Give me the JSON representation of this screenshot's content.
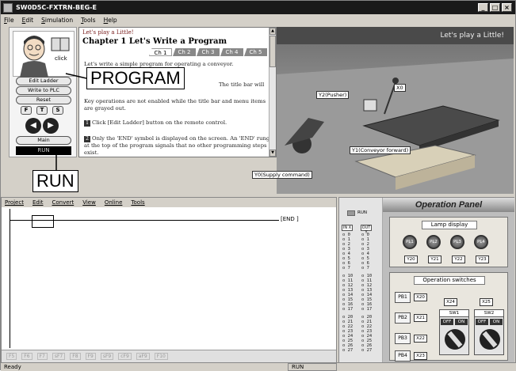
{
  "window": {
    "title": "SW0D5C-FXTRN-BEG-E",
    "btn_min": "_",
    "btn_max": "□",
    "btn_close": "×"
  },
  "menu": [
    "File",
    "Edit",
    "Simulation",
    "Tools",
    "Help"
  ],
  "remote": {
    "click_label": "click",
    "edit_ladder": "Edit Ladder",
    "write_plc": "Write to PLC",
    "reset": "Reset",
    "f": "F",
    "t": "T",
    "s": "S",
    "left": "◀",
    "right": "▶",
    "main": "Main",
    "run": "RUN"
  },
  "chapter": {
    "lead": "Let's play a Little!",
    "title": "Chapter 1  Let's Write a Program",
    "tabs": [
      "Ch 1",
      "Ch 2",
      "Ch 3",
      "Ch 4",
      "Ch 5"
    ],
    "p1": "Let's write a simple program for operating a conveyor.",
    "p2": "The title bar will",
    "p3": "Key operations are not enabled while the title bar and menu items are grayed out.",
    "s1": "1",
    "step1": "Click [Edit Ladder] button on the remote control.",
    "s2": "2",
    "step2": "Only the 'END' symbol is displayed on the screen. An 'END' rung at the top of the program signals that no other programming steps exist."
  },
  "scene": {
    "banner": "Let's play a Little!",
    "labels": {
      "y2": "Y2(Pusher)",
      "x0": "X0",
      "y1": "Y1(Conveyor forward)",
      "y0": "Y0(Supply command)"
    }
  },
  "callouts": {
    "program": "PROGRAM",
    "run": "RUN"
  },
  "ladder": {
    "menu": [
      "Project",
      "Edit",
      "Convert",
      "View",
      "Online",
      "Tools"
    ],
    "end": "[END ]",
    "toolbar": [
      "F5",
      "F6",
      "F7",
      "sF7",
      "F8",
      "F9",
      "sF9",
      "cF9",
      "aF9",
      "F10"
    ]
  },
  "status": {
    "left": "Ready",
    "mode": "RUN"
  },
  "op": {
    "title": "Operation Panel",
    "run": "RUN",
    "in_hdr": "IN X",
    "out_hdr": "OUT Y",
    "io_in": [
      "0",
      "1",
      "2",
      "3",
      "4",
      "5",
      "6",
      "7",
      "10",
      "11",
      "12",
      "13",
      "14",
      "15",
      "16",
      "17",
      "20",
      "21",
      "22",
      "23",
      "24",
      "25",
      "26",
      "27"
    ],
    "io_out": [
      "0",
      "1",
      "2",
      "3",
      "4",
      "5",
      "6",
      "7",
      "10",
      "11",
      "12",
      "13",
      "14",
      "15",
      "16",
      "17",
      "20",
      "21",
      "22",
      "23",
      "24",
      "25",
      "26",
      "27"
    ],
    "lamp_hdr": "Lamp display",
    "lamps": [
      "PL1",
      "PL2",
      "PL3",
      "PL4"
    ],
    "lamp_y": [
      "Y20",
      "Y21",
      "Y22",
      "Y23"
    ],
    "sw_hdr": "Operation switches",
    "pbs": [
      "PB1",
      "PB2",
      "PB3",
      "PB4"
    ],
    "pbx": [
      "X20",
      "X21",
      "X22",
      "X23"
    ],
    "x24": "X24",
    "x25": "X25",
    "sw1": "SW1",
    "sw2": "SW2",
    "off": "OFF",
    "on": "ON"
  }
}
